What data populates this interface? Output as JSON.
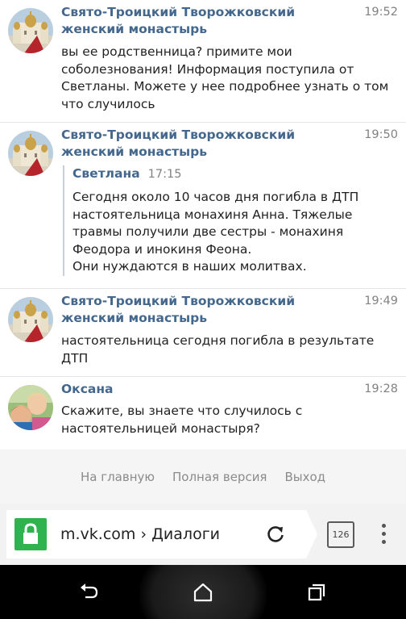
{
  "messages": [
    {
      "author": "Свято-Троицкий Творожковский женский монастырь",
      "time": "19:52",
      "text": "вы ее родственница? примите мои соболезнования! Информация поступила от Светланы. Можете у нее подробнее узнать о том что случилось"
    },
    {
      "author": "Свято-Троицкий Творожковский женский монастырь",
      "time": "19:50",
      "quote": {
        "author": "Светлана",
        "time": "17:15",
        "text": "Сегодня около 10 часов дня погибла в ДТП настоятельница монахиня Анна. Тяжелые травмы получили две сестры - монахиня Феодора и инокиня Феона.",
        "text2": "Они нуждаются в наших молитвах."
      }
    },
    {
      "author": "Свято-Троицкий Творожковский женский монастырь",
      "time": "19:49",
      "text": "настоятельница сегодня погибла в результате ДТП"
    },
    {
      "author": "Оксана",
      "time": "19:28",
      "text": "Скажите, вы знаете что случилось с настоятельницей монастыря?"
    }
  ],
  "footer": {
    "home": "На главную",
    "full_version": "Полная версия",
    "logout": "Выход"
  },
  "browser": {
    "url": "m.vk.com › Диалоги",
    "tab_count": "126",
    "secure_color": "#2eb34e"
  },
  "icons": {
    "lock": "lock-icon",
    "reload": "reload-icon",
    "tabs": "tabs-counter-icon",
    "menu": "overflow-menu-icon",
    "back": "back-icon",
    "home": "home-icon",
    "recents": "recents-icon"
  },
  "colors": {
    "author": "#44678d",
    "time": "#828282",
    "footer_bg": "#f5f5f5",
    "navbar": "#000000"
  }
}
